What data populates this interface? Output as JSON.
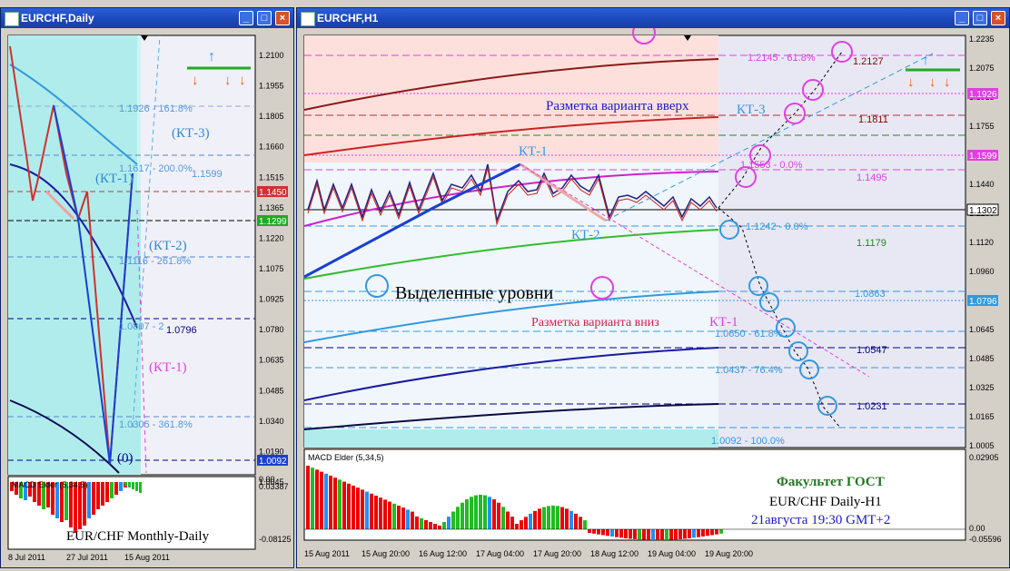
{
  "left_window": {
    "title": "EURCHF,Daily",
    "price_ticks": [
      "1.2100",
      "1.1955",
      "1.1805",
      "1.1660",
      "1.1515",
      "1.1365",
      "1.1220",
      "1.1075",
      "1.0925",
      "1.0780",
      "1.0635",
      "1.0485",
      "1.0340",
      "1.0190",
      "1.0045"
    ],
    "price_badges": {
      "red": "1.1450",
      "green": "1.1299",
      "blue": "1.0092"
    },
    "fib_labels": [
      {
        "text": "1.1926 - 161.8%"
      },
      {
        "text": "1.1617 - 200.0%"
      },
      {
        "text": "1.1599"
      },
      {
        "text": "1.1116 - 261.8%"
      },
      {
        "text": "1.0807 - 2"
      },
      {
        "text": "1.0796"
      },
      {
        "text": "1.0305 - 361.8%"
      }
    ],
    "wave_labels": [
      "(КТ-3)",
      "(КТ-1)",
      "(КТ-2)",
      "(КТ-1)",
      "(0)"
    ],
    "macd": {
      "label": "MACD Elder (5,34,5)",
      "ticks": [
        "0.03387",
        "-0.08125"
      ],
      "zero_tick": "0.00"
    },
    "bottom_caption": "EUR/CHF Monthly-Daily",
    "x_ticks": [
      "8 Jul 2011",
      "27 Jul 2011",
      "15 Aug 2011"
    ]
  },
  "right_window": {
    "title": "EURCHF,H1",
    "price_ticks": [
      "1.2235",
      "1.2075",
      "1.1915",
      "1.1755",
      "1.1595",
      "1.1440",
      "1.1280",
      "1.1120",
      "1.0960",
      "1.0800",
      "1.0645",
      "1.0485",
      "1.0325",
      "1.0165",
      "1.0005"
    ],
    "price_badges": {
      "magenta_top": "1.1926",
      "magenta": "1.1599",
      "black": "1.1302",
      "blue": "1.0796"
    },
    "level_labels": [
      {
        "text": "1.2145 - 61.8%",
        "color": "#e040e0"
      },
      {
        "text": "1.2127",
        "color": "#8b0000"
      },
      {
        "text": "1.1811",
        "color": "#8b0000"
      },
      {
        "text": "1.1553 - 0.0%",
        "color": "#e040e0"
      },
      {
        "text": "1.1495",
        "color": "#e040e0"
      },
      {
        "text": "1.1242 - 0.0%",
        "color": "#3399dd"
      },
      {
        "text": "1.1179",
        "color": "#228822"
      },
      {
        "text": "1.0863",
        "color": "#3399dd"
      },
      {
        "text": "1.0650 - 61.8%",
        "color": "#3399dd"
      },
      {
        "text": "1.0547",
        "color": "#000080"
      },
      {
        "text": "1.0437 - 76.4%",
        "color": "#3399dd"
      },
      {
        "text": "1.0231",
        "color": "#000080"
      },
      {
        "text": "1.0092 - 100.0%",
        "color": "#3399dd"
      }
    ],
    "annotations": {
      "up_markup": "Разметка варианта вверх",
      "kt3": "КТ-3",
      "kt1_top": "КТ-1",
      "kt2": "КТ-2",
      "highlighted": "Выделенные уровни",
      "down_markup": "Разметка варианта вниз",
      "kt1_down": "КТ-1"
    },
    "macd": {
      "label": "MACD Elder (5,34,5)",
      "ticks": [
        "0.02905",
        "0.00",
        "-0.05596"
      ]
    },
    "info": {
      "faculty": "Факультет ГОСТ",
      "pair": "EUR/CHF Daily-H1",
      "date": "21августа 19:30 GMT+2"
    },
    "x_ticks": [
      "15 Aug 2011",
      "15 Aug 20:00",
      "16 Aug 12:00",
      "17 Aug 04:00",
      "17 Aug 20:00",
      "18 Aug 12:00",
      "19 Aug 04:00",
      "19 Aug 20:00"
    ]
  },
  "chart_data": [
    {
      "type": "line",
      "title": "EURCHF,Daily",
      "x": [
        "8 Jul 2011",
        "27 Jul 2011",
        "15 Aug 2011"
      ],
      "series": [
        {
          "values": [
            1.212,
            1.16,
            1.14,
            1.19,
            1.13,
            1.0092,
            1.16
          ]
        }
      ],
      "ylim": [
        1.0045,
        1.21
      ]
    },
    {
      "type": "line",
      "title": "EURCHF,H1",
      "x": [
        "15 Aug 2011",
        "15 Aug 20:00",
        "16 Aug 12:00",
        "17 Aug 04:00",
        "17 Aug 20:00",
        "18 Aug 12:00",
        "19 Aug 04:00",
        "19 Aug 20:00"
      ],
      "series": [
        {
          "values": [
            1.135,
            1.125,
            1.14,
            1.155,
            1.135,
            1.128,
            1.132,
            1.1302
          ]
        }
      ],
      "ylim": [
        1.0005,
        1.2235
      ]
    }
  ]
}
